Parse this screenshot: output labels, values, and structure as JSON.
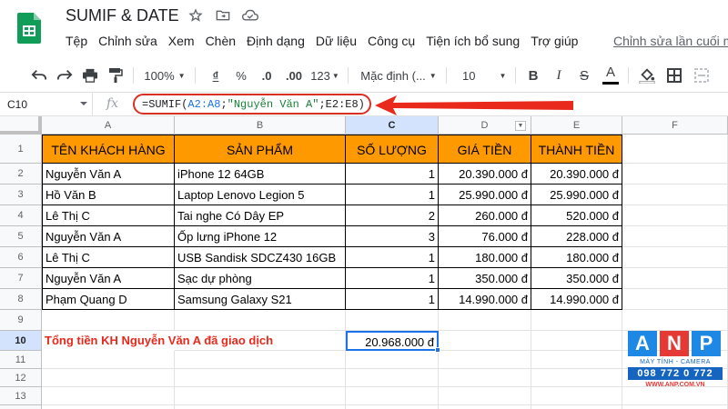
{
  "header": {
    "title": "SUMIF & DATE",
    "last_edit": "Chỉnh sửa lần cuối m",
    "menu": [
      "Tệp",
      "Chỉnh sửa",
      "Xem",
      "Chèn",
      "Định dạng",
      "Dữ liệu",
      "Công cụ",
      "Tiện ích bổ sung",
      "Trợ giúp"
    ]
  },
  "toolbar": {
    "zoom": "100%",
    "currency": "₫",
    "percent": "%",
    "decrease_decimal": ".0",
    "increase_decimal": ".00",
    "more_formats": "123",
    "font": "Mặc định (...",
    "font_size": "10",
    "bold": "B",
    "italic": "I",
    "strike": "S",
    "text_color": "A"
  },
  "formula_bar": {
    "name_box": "C10",
    "fx": "fx",
    "formula": {
      "p1": "=SUMIF(",
      "p2": "A2:A8",
      "p3": ";",
      "p4": "\"Nguyễn Văn A\"",
      "p5": ";E2:E8)"
    }
  },
  "columns": [
    "A",
    "B",
    "C",
    "D",
    "E",
    "F"
  ],
  "rows": [
    "1",
    "2",
    "3",
    "4",
    "5",
    "6",
    "7",
    "8",
    "9",
    "10",
    "11",
    "12",
    "13",
    "14"
  ],
  "table": {
    "headers": [
      "TÊN KHÁCH HÀNG",
      "SẢN PHẨM",
      "SỐ LƯỢNG",
      "GIÁ TIỀN",
      "THÀNH TIỀN"
    ],
    "rows": [
      [
        "Nguyễn Văn A",
        "iPhone 12 64GB",
        "1",
        "20.390.000 đ",
        "20.390.000 đ"
      ],
      [
        "Hồ Văn B",
        "Laptop Lenovo Legion 5",
        "1",
        "25.990.000 đ",
        "25.990.000 đ"
      ],
      [
        "Lê Thị C",
        "Tai nghe Có Dây EP",
        "2",
        "260.000 đ",
        "520.000 đ"
      ],
      [
        "Nguyễn Văn A",
        "Ốp lưng iPhone 12",
        "3",
        "76.000 đ",
        "228.000 đ"
      ],
      [
        "Lê Thị C",
        "USB Sandisk SDCZ430 16GB",
        "1",
        "180.000 đ",
        "180.000 đ"
      ],
      [
        "Nguyễn Văn A",
        "Sạc dự phòng",
        "1",
        "350.000 đ",
        "350.000 đ"
      ],
      [
        "Phạm Quang D",
        "Samsung Galaxy S21",
        "1",
        "14.990.000 đ",
        "14.990.000 đ"
      ]
    ]
  },
  "summary": {
    "label": "Tổng tiền KH Nguyễn Văn A đã giao dịch",
    "value": "20.968.000 đ"
  },
  "watermark": {
    "letters": [
      "A",
      "N",
      "P"
    ],
    "sub": "MÁY TÍNH - CAMERA",
    "phone": "098 772 0 772",
    "web": "WWW.ANP.COM.VN"
  },
  "colors": {
    "header_fill": "#ff9900",
    "summary_text": "#e8291c",
    "selection": "#1a73e8",
    "annotation": "#d93025"
  }
}
